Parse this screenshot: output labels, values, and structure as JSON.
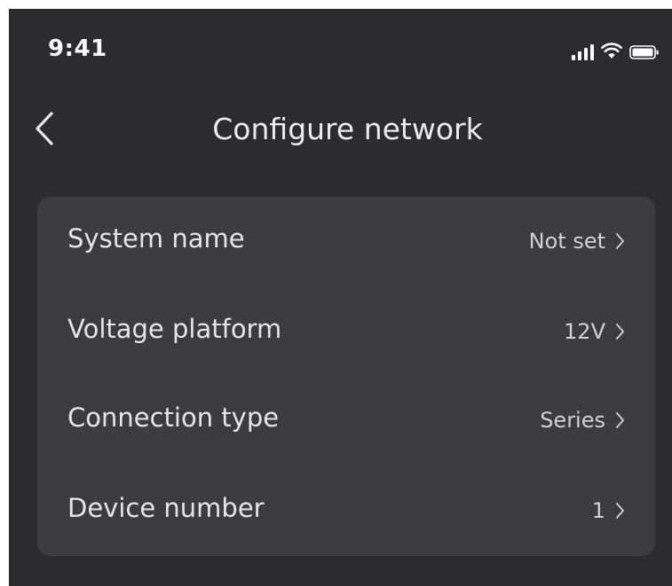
{
  "status_bar": {
    "time": "9:41",
    "icons": [
      "cellular-signal-icon",
      "wifi-icon",
      "battery-icon"
    ]
  },
  "nav": {
    "back_icon": "chevron-left-icon",
    "title": "Configure network"
  },
  "settings": {
    "items": [
      {
        "label": "System name",
        "value": "Not set"
      },
      {
        "label": "Voltage platform",
        "value": "12V"
      },
      {
        "label": "Connection type",
        "value": "Series"
      },
      {
        "label": "Device number",
        "value": "1"
      }
    ]
  },
  "colors": {
    "background": "#2a2c30",
    "card": "#3a3c41",
    "text": "#e4e5e7",
    "value_text": "#cfd1d4"
  }
}
